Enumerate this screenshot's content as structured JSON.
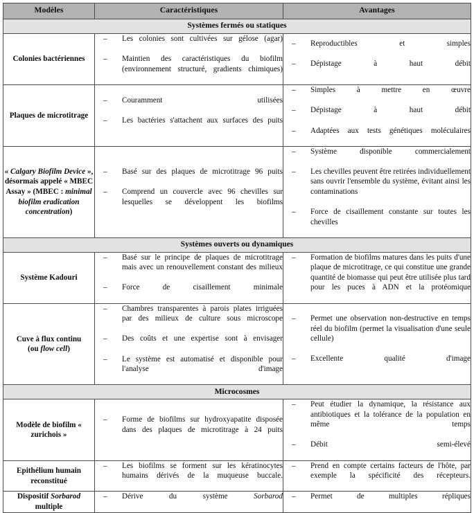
{
  "document": {
    "type": "table",
    "language": "fr",
    "colors": {
      "header_background": "#b2b2b2",
      "section_background": "#e2e2e2",
      "border": "#4a4a4a",
      "text": "#0d0d0d",
      "page_background": "#ffffff"
    }
  },
  "table": {
    "columns": [
      {
        "id": "models",
        "label": "Modèles"
      },
      {
        "id": "characteristics",
        "label": "Caractéristiques"
      },
      {
        "id": "advantages",
        "label": "Avantages"
      }
    ],
    "bullet_marker": "–",
    "sections": [
      {
        "id": "systemes-fermes",
        "title": "Systèmes fermés ou statiques",
        "rows": [
          {
            "id": "colonies-bacteriennes",
            "model": "Colonies bactériennes",
            "characteristics": [
              "Les colonies sont cultivées sur gélose (agar)",
              "Maintien des caractéristiques du biofilm (environnement structuré, gradients chimiques)"
            ],
            "advantages": [
              "Reproductibles et simples",
              "Dépistage à haut débit"
            ]
          },
          {
            "id": "plaques-de-microtitrage",
            "model": "Plaques de microtitrage",
            "characteristics": [
              "Couramment utilisées",
              "Les bactéries s'attachent aux surfaces des puits"
            ],
            "advantages": [
              "Simples à mettre en œuvre",
              "Dépistage à haut débit",
              "Adaptées aux tests génétiques moléculaires"
            ]
          },
          {
            "id": "calgary-biofilm-device",
            "model": "« Calgary Biofilm Device », désormais appelé « MBEC Assay » (MBEC : minimal biofilm eradication concentration)",
            "model_parts": [
              {
                "text": "« ",
                "style": "bold"
              },
              {
                "text": "Calgary Biofilm Device",
                "style": "bold-italic"
              },
              {
                "text": " », désormais appelé « MBEC Assay » (MBEC : ",
                "style": "bold"
              },
              {
                "text": "minimal biofilm eradication concentration",
                "style": "bold-italic"
              },
              {
                "text": ")",
                "style": "bold"
              }
            ],
            "characteristics": [
              "Basé sur des plaques de microtitrage 96 puits",
              "Comprend un couvercle avec 96 chevilles sur lesquelles se développent les biofilms"
            ],
            "advantages": [
              "Système disponible commercialement",
              "Les chevilles peuvent être retirées individuellement sans ouvrir l'ensemble du système, évitant ainsi les contaminations",
              "Force de cisaillement constante sur toutes les chevilles"
            ]
          }
        ]
      },
      {
        "id": "systemes-ouverts",
        "title": "Systèmes ouverts ou dynamiques",
        "rows": [
          {
            "id": "systeme-kadouri",
            "model": "Système Kadouri",
            "characteristics": [
              "Basé sur le principe de plaques de microtitrage mais avec un renouvellement constant des milieux",
              "Force de cisaillement minimale"
            ],
            "advantages": [
              "Formation de biofilms matures dans les puits d'une plaque de microtitrage, ce qui constitue une grande quantité de biomasse qui peut être utilisée plus tard pour les puces à ADN et la protéomique"
            ]
          },
          {
            "id": "cuve-a-flux-continu",
            "model": "Cuve à flux continu (ou flow cell)",
            "model_parts": [
              {
                "text": "Cuve à flux continu",
                "style": "bold"
              },
              {
                "text": "\n",
                "style": "break"
              },
              {
                "text": "(ou ",
                "style": "bold"
              },
              {
                "text": "flow cell",
                "style": "bold-italic"
              },
              {
                "text": ")",
                "style": "bold"
              }
            ],
            "characteristics": [
              "Chambres transparentes à parois plates irriguées par des milieux de culture sous microscope",
              "Des coûts et une expertise sont à envisager",
              "Le système est automatisé et disponible pour l'analyse d'image"
            ],
            "advantages": [
              "Permet une observation non-destructive en temps réel du biofilm (permet la visualisation d'une seule cellule)",
              "Excellente qualité d'image"
            ]
          }
        ]
      },
      {
        "id": "microcosmes",
        "title": "Microcosmes",
        "rows": [
          {
            "id": "modele-biofilm-zurichois",
            "model": "Modèle de biofilm « zurichois »",
            "characteristics": [
              "Forme de biofilms sur hydroxyapatite disposée dans des plaques de microtitrage à 24 puits"
            ],
            "advantages": [
              "Peut étudier la dynamique, la résistance aux antibiotiques et la tolérance de la population en même temps",
              "Débit semi-élevé"
            ]
          },
          {
            "id": "epithelium-humain-reconstitue",
            "model": "Epithélium humain reconstitué",
            "characteristics": [
              "Les biofilms se forment sur les kératinocytes humains dérivés de la muqueuse buccale."
            ],
            "advantages": [
              "Prend en compte certains facteurs de l'hôte, par exemple la spécificité des récepteurs."
            ]
          },
          {
            "id": "dispositif-sorbarod-multiple",
            "model": "Dispositif Sorbarod multiple",
            "model_parts": [
              {
                "text": "Dispositif ",
                "style": "bold"
              },
              {
                "text": "Sorbarod",
                "style": "bold-italic"
              },
              {
                "text": " multiple",
                "style": "bold"
              }
            ],
            "characteristics": [
              {
                "parts": [
                  {
                    "text": "Dérive du système ",
                    "style": "normal"
                  },
                  {
                    "text": "Sorbarod",
                    "style": "italic"
                  }
                ]
              }
            ],
            "advantages": [
              "Permet de multiples répliques"
            ]
          }
        ]
      }
    ]
  }
}
